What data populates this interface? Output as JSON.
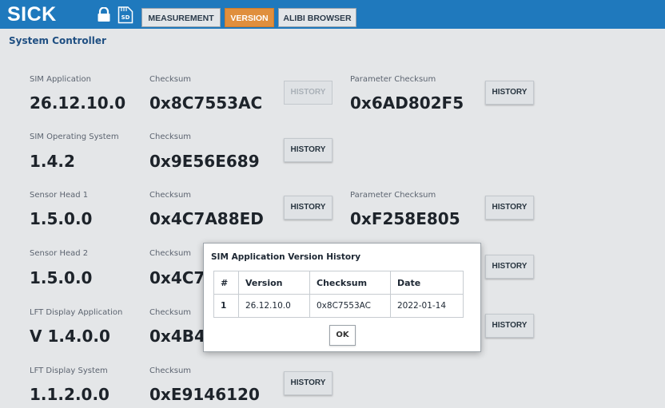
{
  "header": {
    "logo": "SICK",
    "nav": [
      "MEASUREMENT",
      "VERSION",
      "ALIBI BROWSER"
    ],
    "active_tab": "VERSION",
    "sd_label": "SD"
  },
  "section_title": "System Controller",
  "history_label": "HISTORY",
  "rows": [
    {
      "label": "SIM Application",
      "value": "26.12.10.0",
      "checksum_label": "Checksum",
      "checksum": "0x8C7553AC",
      "history_disabled": true,
      "param_label": "Parameter Checksum",
      "param_checksum": "0x6AD802F5"
    },
    {
      "label": "SIM Operating System",
      "value": "1.4.2",
      "checksum_label": "Checksum",
      "checksum": "0x9E56E689"
    },
    {
      "label": "Sensor Head 1",
      "value": "1.5.0.0",
      "checksum_label": "Checksum",
      "checksum": "0x4C7A88ED",
      "param_label": "Parameter Checksum",
      "param_checksum": "0xF258E805"
    },
    {
      "label": "Sensor Head 2",
      "value": "1.5.0.0",
      "checksum_label": "Checksum",
      "checksum": "0x4C7/"
    },
    {
      "label": "LFT Display Application",
      "value": "V 1.4.0.0",
      "checksum_label": "Checksum",
      "checksum": "0x4B4"
    },
    {
      "label": "LFT Display System",
      "value": "1.1.2.0.0",
      "checksum_label": "Checksum",
      "checksum": "0xE9146120"
    }
  ],
  "dialog": {
    "title": "SIM Application Version History",
    "columns": [
      "#",
      "Version",
      "Checksum",
      "Date"
    ],
    "rows": [
      [
        "1",
        "26.12.10.0",
        "0x8C7553AC",
        "2022-01-14"
      ]
    ],
    "ok_label": "OK"
  },
  "colors": {
    "header": "#1f79bd",
    "active_tab": "#e08f3d",
    "section_title": "#1f4f82"
  }
}
